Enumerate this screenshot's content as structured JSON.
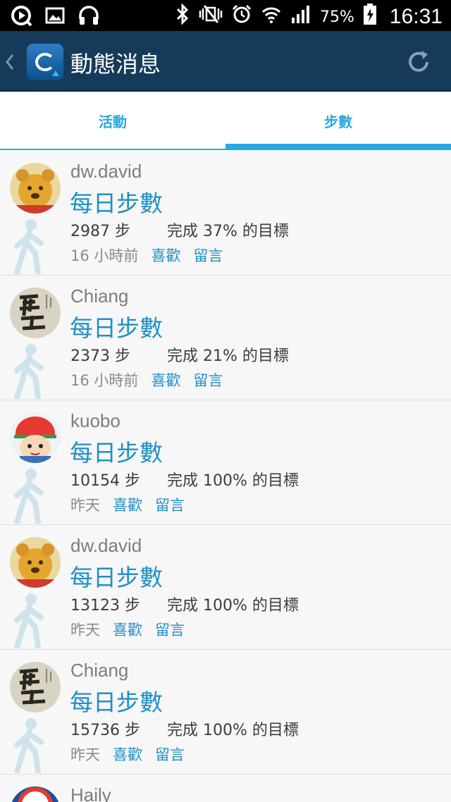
{
  "status_bar": {
    "icons_left": [
      "play-circle-icon",
      "image-icon",
      "headphones-icon"
    ],
    "icons_right": [
      "bluetooth-icon",
      "mute-vibrate-icon",
      "alarm-icon",
      "wifi-icon",
      "signal-icon",
      "battery-icon"
    ],
    "battery": "75%",
    "time": "16:31"
  },
  "app_bar": {
    "title": "動態消息"
  },
  "tabs": [
    {
      "label": "活動",
      "selected": false
    },
    {
      "label": "步數",
      "selected": true
    }
  ],
  "colors": {
    "app_bar": "#163b5a",
    "accent": "#2aa7de",
    "link": "#1f8fc8"
  },
  "feed": [
    {
      "name": "dw.david",
      "headline": "每日步數",
      "steps": "2987 步",
      "goal": "完成 37% 的目標",
      "time": "16 小時前",
      "like": "喜歡",
      "comment": "留言",
      "avatar": "bear-avatar"
    },
    {
      "name": "Chiang",
      "headline": "每日步數",
      "steps": "2373 步",
      "goal": "完成 21% 的目標",
      "time": "16 小時前",
      "like": "喜歡",
      "comment": "留言",
      "avatar": "calligraphy-avatar"
    },
    {
      "name": "kuobo",
      "headline": "每日步數",
      "steps": "10154 步",
      "goal": "完成 100% 的目標",
      "time": "昨天",
      "like": "喜歡",
      "comment": "留言",
      "avatar": "baseball-avatar"
    },
    {
      "name": "dw.david",
      "headline": "每日步數",
      "steps": "13123 步",
      "goal": "完成 100% 的目標",
      "time": "昨天",
      "like": "喜歡",
      "comment": "留言",
      "avatar": "bear-avatar"
    },
    {
      "name": "Chiang",
      "headline": "每日步數",
      "steps": "15736 步",
      "goal": "完成 100% 的目標",
      "time": "昨天",
      "like": "喜歡",
      "comment": "留言",
      "avatar": "calligraphy-avatar"
    },
    {
      "name": "Haily",
      "avatar": "haily-avatar"
    }
  ]
}
